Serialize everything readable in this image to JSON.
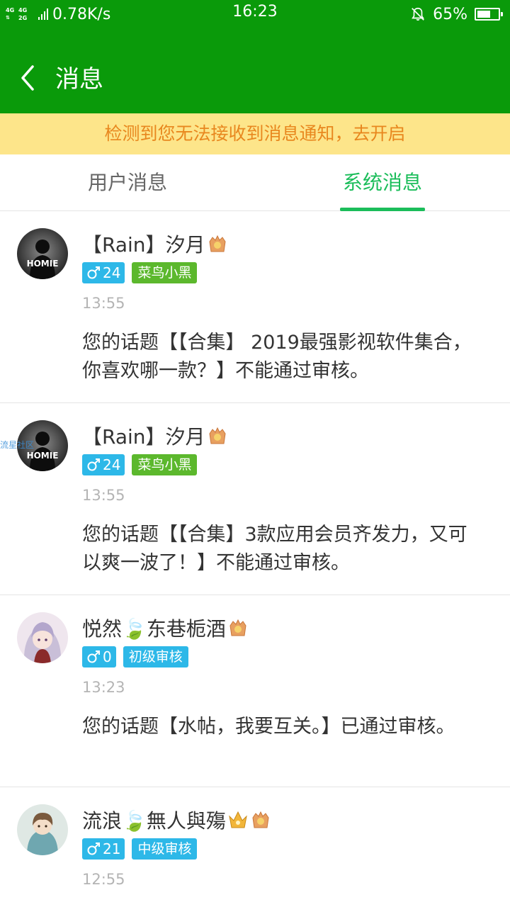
{
  "status_bar": {
    "network_top": "4G",
    "network_mid": "4G",
    "network_bot": "2G",
    "speed": "0.78K/s",
    "time": "16:23",
    "battery_percent": "65%",
    "battery_level": 0.65
  },
  "header": {
    "title": "消息"
  },
  "notice": {
    "text": "检测到您无法接收到消息通知，去开启"
  },
  "tabs": [
    {
      "label": "用户消息",
      "active": false
    },
    {
      "label": "系统消息",
      "active": true
    }
  ],
  "colors": {
    "brand_green": "#0a9a0a",
    "tab_active": "#1bbd5a",
    "notice_bg": "#fde58a",
    "notice_text": "#e8871e",
    "gender_bg": "#2db8e8",
    "level_green": "#5cb82d",
    "level_blue": "#2db8e8"
  },
  "messages": [
    {
      "username": "【Rain】汐月",
      "avatar": "homie-avatar",
      "avatar_text": "HOMIE",
      "gender": "male",
      "age": "24",
      "level": "菜鸟小黑",
      "level_color": "#5cb82d",
      "time": "13:55",
      "content": "您的话题【【合集】 2019最强影视软件集合，你喜欢哪一款？】不能通过审核。"
    },
    {
      "username": "【Rain】汐月",
      "avatar": "homie-avatar",
      "avatar_text": "HOMIE",
      "avatar_overlay": "流星社区",
      "gender": "male",
      "age": "24",
      "level": "菜鸟小黑",
      "level_color": "#5cb82d",
      "time": "13:55",
      "content": "您的话题【【合集】3款应用会员齐发力，又可以爽一波了！】不能通过审核。"
    },
    {
      "username": "悦然🍃东巷栀酒",
      "avatar": "anime-girl-avatar",
      "gender": "male",
      "age": "0",
      "level": "初级审核",
      "level_color": "#2db8e8",
      "time": "13:23",
      "content": "您的话题【水帖，我要互关。】已通过审核。"
    },
    {
      "username": "流浪🍃無人與殤",
      "avatar": "anime-boy-avatar",
      "gender": "male",
      "age": "21",
      "level": "中级审核",
      "level_color": "#2db8e8",
      "time": "12:55",
      "content": ""
    }
  ]
}
